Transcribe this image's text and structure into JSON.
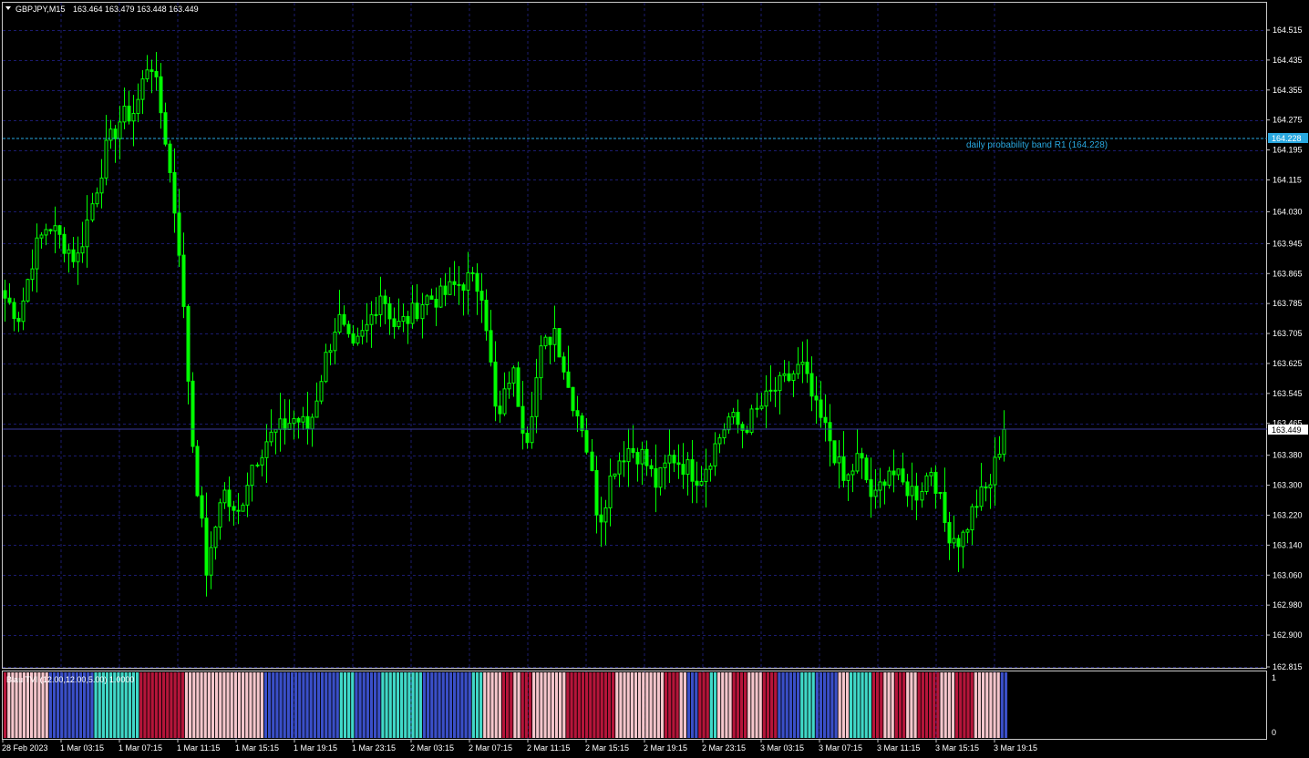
{
  "header": {
    "symbol_info": "GBPJPY,M15",
    "ohlc": "163.464 163.479 163.448 163.449"
  },
  "price_axis": {
    "ticks": [
      "164.515",
      "164.435",
      "164.355",
      "164.275",
      "164.195",
      "164.115",
      "164.030",
      "163.945",
      "163.865",
      "163.785",
      "163.705",
      "163.625",
      "163.545",
      "163.465",
      "163.380",
      "163.300",
      "163.220",
      "163.140",
      "163.060",
      "162.980",
      "162.900",
      "162.815"
    ],
    "current_price_label": "163.449",
    "band_price_label": "164.228"
  },
  "band": {
    "label": "daily probability band R1 (164.228)"
  },
  "indicator": {
    "label": "Blau TVI (12.00,12.00,5.00) 1.0000",
    "scale_top": "1",
    "scale_bottom": "0"
  },
  "time_axis": {
    "labels": [
      "28 Feb 2023",
      "1 Mar 03:15",
      "1 Mar 07:15",
      "1 Mar 11:15",
      "1 Mar 15:15",
      "1 Mar 19:15",
      "1 Mar 23:15",
      "2 Mar 03:15",
      "2 Mar 07:15",
      "2 Mar 11:15",
      "2 Mar 15:15",
      "2 Mar 19:15",
      "2 Mar 23:15",
      "3 Mar 03:15",
      "3 Mar 07:15",
      "3 Mar 11:15",
      "3 Mar 15:15",
      "3 Mar 19:15"
    ]
  },
  "colors": {
    "background": "#000000",
    "candle": "#00ff00",
    "grid": "#1b1b6e",
    "band_line": "#29a8e0",
    "current_price_line": "#3a3a9a",
    "tvi_dark_red": "#b5153a",
    "tvi_light_pink": "#f5c6cc",
    "tvi_blue": "#3a4fc8",
    "tvi_teal": "#40d8c8"
  },
  "chart_data": {
    "type": "candlestick",
    "symbol": "GBPJPY",
    "timeframe": "M15",
    "ylim": [
      162.815,
      164.515
    ],
    "band_level": 164.228,
    "last_close": 163.449,
    "close_path": [
      {
        "t": "28 Feb 2023 23:15",
        "v": 163.8
      },
      {
        "t": "1 Mar 00:15",
        "v": 163.75
      },
      {
        "t": "1 Mar 01:15",
        "v": 163.92
      },
      {
        "t": "1 Mar 02:15",
        "v": 164.0
      },
      {
        "t": "1 Mar 03:15",
        "v": 163.95
      },
      {
        "t": "1 Mar 04:15",
        "v": 163.9
      },
      {
        "t": "1 Mar 05:15",
        "v": 164.05
      },
      {
        "t": "1 Mar 06:15",
        "v": 164.2
      },
      {
        "t": "1 Mar 07:15",
        "v": 164.28
      },
      {
        "t": "1 Mar 08:15",
        "v": 164.3
      },
      {
        "t": "1 Mar 08:45",
        "v": 164.45
      },
      {
        "t": "1 Mar 09:15",
        "v": 164.25
      },
      {
        "t": "1 Mar 10:15",
        "v": 163.95
      },
      {
        "t": "1 Mar 11:15",
        "v": 163.4
      },
      {
        "t": "1 Mar 12:15",
        "v": 163.05
      },
      {
        "t": "1 Mar 13:15",
        "v": 163.3
      },
      {
        "t": "1 Mar 14:15",
        "v": 163.2
      },
      {
        "t": "1 Mar 15:15",
        "v": 163.35
      },
      {
        "t": "1 Mar 16:15",
        "v": 163.42
      },
      {
        "t": "1 Mar 17:15",
        "v": 163.45
      },
      {
        "t": "1 Mar 18:15",
        "v": 163.48
      },
      {
        "t": "1 Mar 19:15",
        "v": 163.45
      },
      {
        "t": "1 Mar 20:15",
        "v": 163.62
      },
      {
        "t": "1 Mar 21:15",
        "v": 163.75
      },
      {
        "t": "1 Mar 22:15",
        "v": 163.65
      },
      {
        "t": "1 Mar 23:15",
        "v": 163.72
      },
      {
        "t": "2 Mar 00:15",
        "v": 163.82
      },
      {
        "t": "2 Mar 01:15",
        "v": 163.72
      },
      {
        "t": "2 Mar 02:15",
        "v": 163.75
      },
      {
        "t": "2 Mar 03:15",
        "v": 163.8
      },
      {
        "t": "2 Mar 04:15",
        "v": 163.8
      },
      {
        "t": "2 Mar 05:15",
        "v": 163.83
      },
      {
        "t": "2 Mar 06:15",
        "v": 163.85
      },
      {
        "t": "2 Mar 07:15",
        "v": 163.82
      },
      {
        "t": "2 Mar 08:15",
        "v": 163.45
      },
      {
        "t": "2 Mar 09:15",
        "v": 163.62
      },
      {
        "t": "2 Mar 10:15",
        "v": 163.42
      },
      {
        "t": "2 Mar 11:15",
        "v": 163.65
      },
      {
        "t": "2 Mar 12:15",
        "v": 163.72
      },
      {
        "t": "2 Mar 13:15",
        "v": 163.55
      },
      {
        "t": "2 Mar 14:15",
        "v": 163.45
      },
      {
        "t": "2 Mar 15:15",
        "v": 163.2
      },
      {
        "t": "2 Mar 16:15",
        "v": 163.35
      },
      {
        "t": "2 Mar 17:15",
        "v": 163.4
      },
      {
        "t": "2 Mar 18:15",
        "v": 163.38
      },
      {
        "t": "2 Mar 19:15",
        "v": 163.3
      },
      {
        "t": "2 Mar 20:15",
        "v": 163.38
      },
      {
        "t": "2 Mar 21:15",
        "v": 163.35
      },
      {
        "t": "2 Mar 22:15",
        "v": 163.32
      },
      {
        "t": "2 Mar 23:15",
        "v": 163.4
      },
      {
        "t": "3 Mar 00:15",
        "v": 163.48
      },
      {
        "t": "3 Mar 01:15",
        "v": 163.45
      },
      {
        "t": "3 Mar 02:15",
        "v": 163.5
      },
      {
        "t": "3 Mar 03:15",
        "v": 163.55
      },
      {
        "t": "3 Mar 04:15",
        "v": 163.58
      },
      {
        "t": "3 Mar 05:15",
        "v": 163.62
      },
      {
        "t": "3 Mar 06:15",
        "v": 163.5
      },
      {
        "t": "3 Mar 07:15",
        "v": 163.42
      },
      {
        "t": "3 Mar 08:15",
        "v": 163.3
      },
      {
        "t": "3 Mar 09:15",
        "v": 163.38
      },
      {
        "t": "3 Mar 10:15",
        "v": 163.25
      },
      {
        "t": "3 Mar 11:15",
        "v": 163.35
      },
      {
        "t": "3 Mar 12:15",
        "v": 163.3
      },
      {
        "t": "3 Mar 13:15",
        "v": 163.28
      },
      {
        "t": "3 Mar 14:15",
        "v": 163.35
      },
      {
        "t": "3 Mar 15:15",
        "v": 163.18
      },
      {
        "t": "3 Mar 16:15",
        "v": 163.15
      },
      {
        "t": "3 Mar 17:15",
        "v": 163.25
      },
      {
        "t": "3 Mar 18:15",
        "v": 163.3
      },
      {
        "t": "3 Mar 19:15",
        "v": 163.449
      }
    ],
    "tvi_segments": [
      {
        "color": "dark_red",
        "bars": 1
      },
      {
        "color": "light_pink",
        "bars": 11
      },
      {
        "color": "blue",
        "bars": 12
      },
      {
        "color": "teal",
        "bars": 12
      },
      {
        "color": "dark_red",
        "bars": 12
      },
      {
        "color": "light_pink",
        "bars": 21
      },
      {
        "color": "blue",
        "bars": 20
      },
      {
        "color": "teal",
        "bars": 4
      },
      {
        "color": "blue",
        "bars": 7
      },
      {
        "color": "teal",
        "bars": 11
      },
      {
        "color": "blue",
        "bars": 13
      },
      {
        "color": "teal",
        "bars": 3
      },
      {
        "color": "light_pink",
        "bars": 5
      },
      {
        "color": "dark_red",
        "bars": 3
      },
      {
        "color": "light_pink",
        "bars": 2
      },
      {
        "color": "dark_red",
        "bars": 3
      },
      {
        "color": "light_pink",
        "bars": 9
      },
      {
        "color": "dark_red",
        "bars": 13
      },
      {
        "color": "light_pink",
        "bars": 13
      },
      {
        "color": "dark_red",
        "bars": 4
      },
      {
        "color": "light_pink",
        "bars": 2
      },
      {
        "color": "blue",
        "bars": 3
      },
      {
        "color": "dark_red",
        "bars": 3
      },
      {
        "color": "teal",
        "bars": 2
      },
      {
        "color": "light_pink",
        "bars": 4
      },
      {
        "color": "dark_red",
        "bars": 4
      },
      {
        "color": "light_pink",
        "bars": 4
      },
      {
        "color": "dark_red",
        "bars": 4
      },
      {
        "color": "blue",
        "bars": 6
      },
      {
        "color": "teal",
        "bars": 4
      },
      {
        "color": "blue",
        "bars": 6
      },
      {
        "color": "light_pink",
        "bars": 3
      },
      {
        "color": "teal",
        "bars": 6
      },
      {
        "color": "dark_red",
        "bars": 3
      },
      {
        "color": "light_pink",
        "bars": 3
      },
      {
        "color": "dark_red",
        "bars": 3
      },
      {
        "color": "light_pink",
        "bars": 3
      },
      {
        "color": "dark_red",
        "bars": 6
      },
      {
        "color": "light_pink",
        "bars": 4
      },
      {
        "color": "dark_red",
        "bars": 5
      },
      {
        "color": "light_pink",
        "bars": 7
      },
      {
        "color": "blue",
        "bars": 2
      }
    ]
  }
}
